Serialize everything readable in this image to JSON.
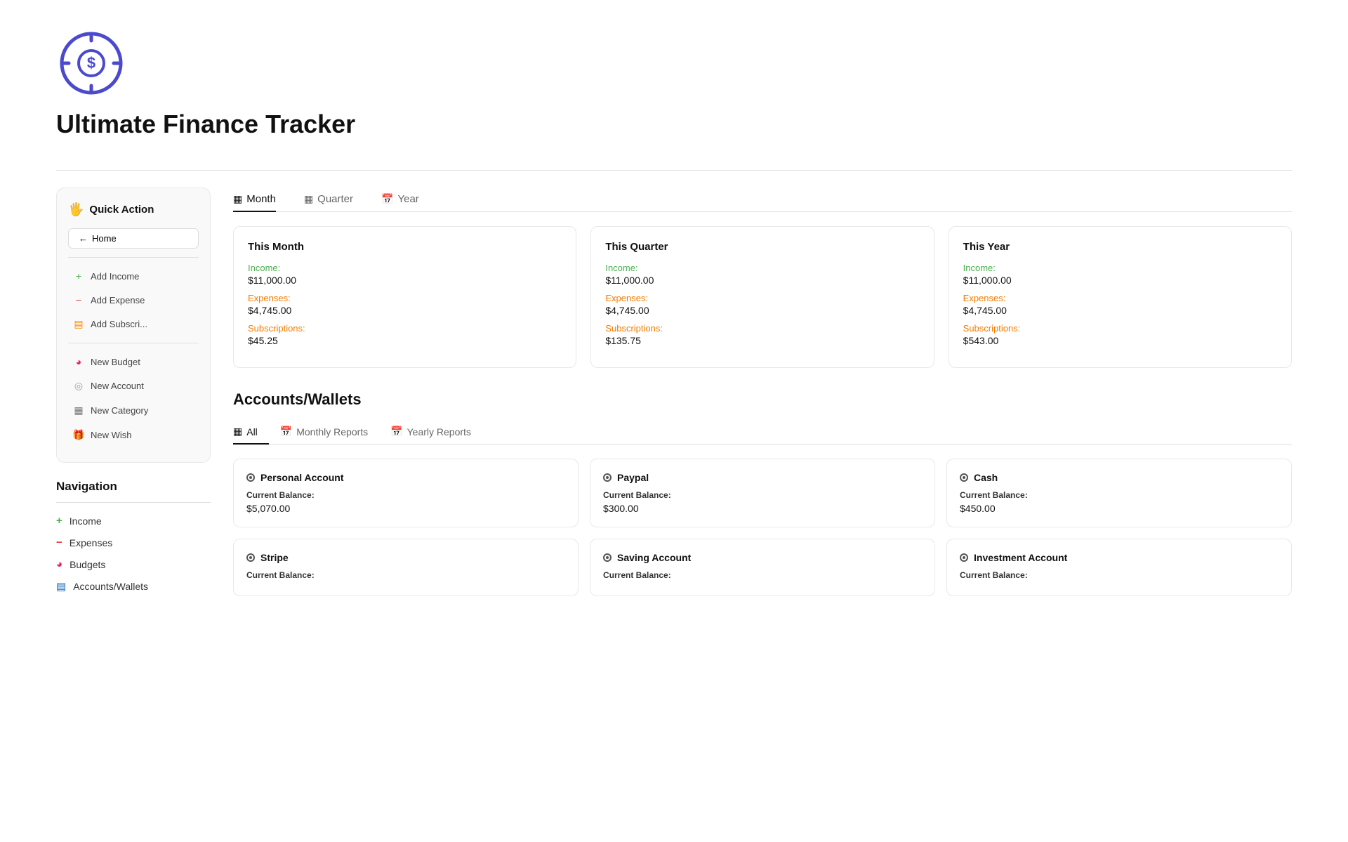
{
  "app": {
    "title": "Ultimate Finance Tracker"
  },
  "sidebar": {
    "header": "Quick Action",
    "home_label": "Home",
    "actions": [
      {
        "id": "add-income",
        "label": "Add Income",
        "icon": "+",
        "icon_type": "green"
      },
      {
        "id": "add-expense",
        "label": "Add Expense",
        "icon": "−",
        "icon_type": "red"
      },
      {
        "id": "add-subscription",
        "label": "Add Subscri...",
        "icon": "▤",
        "icon_type": "orange"
      },
      {
        "id": "new-budget",
        "label": "New Budget",
        "icon": "◕",
        "icon_type": "pink"
      },
      {
        "id": "new-account",
        "label": "New Account",
        "icon": "◎",
        "icon_type": "gray"
      },
      {
        "id": "new-category",
        "label": "New Category",
        "icon": "▦",
        "icon_type": "dark-gray"
      },
      {
        "id": "new-wish",
        "label": "New Wish",
        "icon": "🎁",
        "icon_type": "dark-gray"
      }
    ]
  },
  "navigation": {
    "title": "Navigation",
    "items": [
      {
        "id": "income",
        "label": "Income",
        "icon": "+"
      },
      {
        "id": "expenses",
        "label": "Expenses",
        "icon": "−"
      },
      {
        "id": "budgets",
        "label": "Budgets",
        "icon": "◕"
      },
      {
        "id": "accounts-wallets",
        "label": "Accounts/Wallets",
        "icon": "▤"
      }
    ]
  },
  "period_tabs": [
    {
      "id": "month",
      "label": "Month",
      "active": true
    },
    {
      "id": "quarter",
      "label": "Quarter",
      "active": false
    },
    {
      "id": "year",
      "label": "Year",
      "active": false
    }
  ],
  "summary_cards": [
    {
      "id": "this-month",
      "title": "This Month",
      "income_label": "Income:",
      "income_value": "$11,000.00",
      "expense_label": "Expenses:",
      "expense_value": "$4,745.00",
      "subscription_label": "Subscriptions:",
      "subscription_value": "$45.25"
    },
    {
      "id": "this-quarter",
      "title": "This Quarter",
      "income_label": "Income:",
      "income_value": "$11,000.00",
      "expense_label": "Expenses:",
      "expense_value": "$4,745.00",
      "subscription_label": "Subscriptions:",
      "subscription_value": "$135.75"
    },
    {
      "id": "this-year",
      "title": "This Year",
      "income_label": "Income:",
      "income_value": "$11,000.00",
      "expense_label": "Expenses:",
      "expense_value": "$4,745.00",
      "subscription_label": "Subscriptions:",
      "subscription_value": "$543.00"
    }
  ],
  "accounts_section": {
    "title": "Accounts/Wallets",
    "tabs": [
      {
        "id": "all",
        "label": "All",
        "active": true
      },
      {
        "id": "monthly-reports",
        "label": "Monthly Reports",
        "active": false
      },
      {
        "id": "yearly-reports",
        "label": "Yearly Reports",
        "active": false
      }
    ],
    "accounts": [
      {
        "id": "personal-account",
        "name": "Personal Account",
        "balance_label": "Current Balance:",
        "balance": "$5,070.00"
      },
      {
        "id": "paypal",
        "name": "Paypal",
        "balance_label": "Current Balance:",
        "balance": "$300.00"
      },
      {
        "id": "cash",
        "name": "Cash",
        "balance_label": "Current Balance:",
        "balance": "$450.00"
      },
      {
        "id": "stripe",
        "name": "Stripe",
        "balance_label": "Current Balance:",
        "balance": ""
      },
      {
        "id": "saving-account",
        "name": "Saving Account",
        "balance_label": "Current Balance:",
        "balance": ""
      },
      {
        "id": "investment-account",
        "name": "Investment Account",
        "balance_label": "Current Balance:",
        "balance": ""
      }
    ]
  }
}
